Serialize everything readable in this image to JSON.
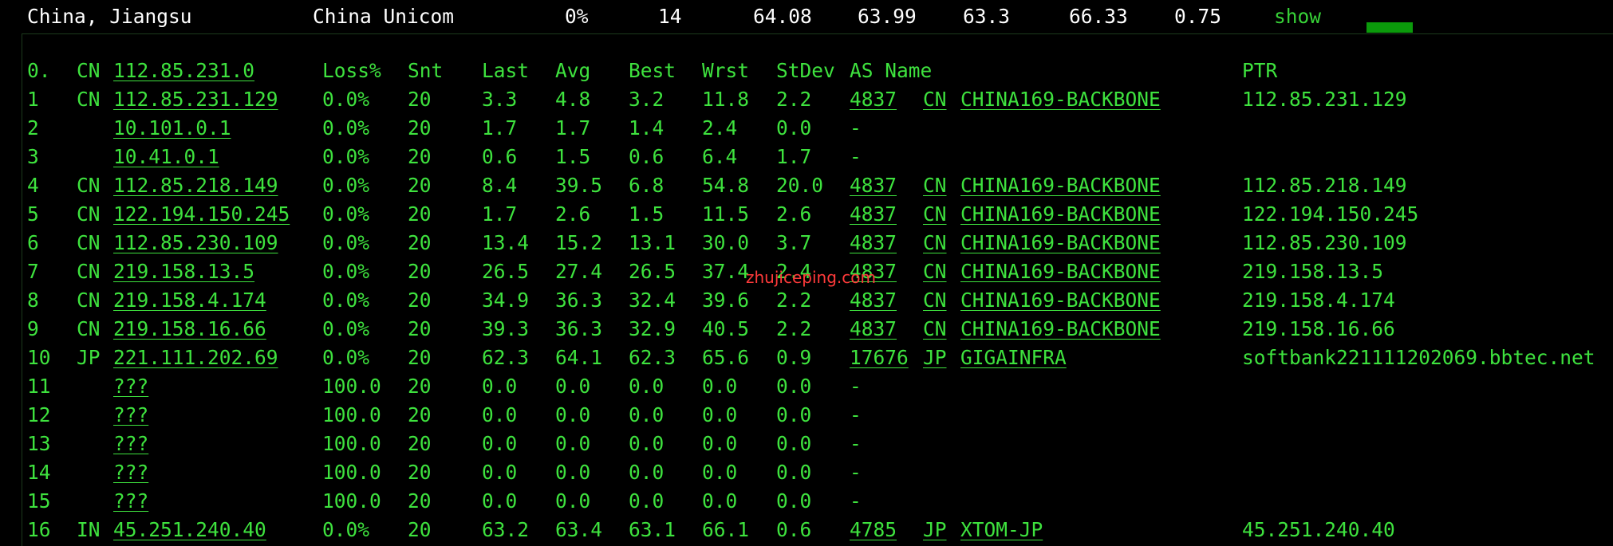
{
  "summary": {
    "location": "China, Jiangsu",
    "isp": "China Unicom",
    "loss": "0%",
    "sent": "14",
    "avg": "64.08",
    "best": "63.99",
    "worst": "63.3",
    "last": "66.33",
    "stdev": "0.75",
    "show_link": "show",
    "bar_color": "#0b9a0b"
  },
  "header": {
    "hop": "0.",
    "cc": "CN",
    "host": "112.85.231.0",
    "loss": "Loss%",
    "snt": "Snt",
    "last": "Last",
    "avg": "Avg",
    "best": "Best",
    "wrst": "Wrst",
    "stdev": "StDev",
    "as_name": "AS Name",
    "ptr": "PTR"
  },
  "rows": [
    {
      "hop": "1",
      "cc": "CN",
      "host": "112.85.231.129",
      "loss": "0.0%",
      "snt": "20",
      "last": "3.3",
      "avg": "4.8",
      "best": "3.2",
      "wrst": "11.8",
      "stdev": "2.2",
      "asn": "4837",
      "as_cc": "CN",
      "as_name": "CHINA169-BACKBONE",
      "ptr": "112.85.231.129"
    },
    {
      "hop": "2",
      "cc": "",
      "host": "10.101.0.1",
      "loss": "0.0%",
      "snt": "20",
      "last": "1.7",
      "avg": "1.7",
      "best": "1.4",
      "wrst": "2.4",
      "stdev": "0.0",
      "asn": "-",
      "as_cc": "",
      "as_name": "",
      "ptr": ""
    },
    {
      "hop": "3",
      "cc": "",
      "host": "10.41.0.1",
      "loss": "0.0%",
      "snt": "20",
      "last": "0.6",
      "avg": "1.5",
      "best": "0.6",
      "wrst": "6.4",
      "stdev": "1.7",
      "asn": "-",
      "as_cc": "",
      "as_name": "",
      "ptr": ""
    },
    {
      "hop": "4",
      "cc": "CN",
      "host": "112.85.218.149",
      "loss": "0.0%",
      "snt": "20",
      "last": "8.4",
      "avg": "39.5",
      "best": "6.8",
      "wrst": "54.8",
      "stdev": "20.0",
      "asn": "4837",
      "as_cc": "CN",
      "as_name": "CHINA169-BACKBONE",
      "ptr": "112.85.218.149"
    },
    {
      "hop": "5",
      "cc": "CN",
      "host": "122.194.150.245",
      "loss": "0.0%",
      "snt": "20",
      "last": "1.7",
      "avg": "2.6",
      "best": "1.5",
      "wrst": "11.5",
      "stdev": "2.6",
      "asn": "4837",
      "as_cc": "CN",
      "as_name": "CHINA169-BACKBONE",
      "ptr": "122.194.150.245"
    },
    {
      "hop": "6",
      "cc": "CN",
      "host": "112.85.230.109",
      "loss": "0.0%",
      "snt": "20",
      "last": "13.4",
      "avg": "15.2",
      "best": "13.1",
      "wrst": "30.0",
      "stdev": "3.7",
      "asn": "4837",
      "as_cc": "CN",
      "as_name": "CHINA169-BACKBONE",
      "ptr": "112.85.230.109"
    },
    {
      "hop": "7",
      "cc": "CN",
      "host": "219.158.13.5",
      "loss": "0.0%",
      "snt": "20",
      "last": "26.5",
      "avg": "27.4",
      "best": "26.5",
      "wrst": "37.4",
      "stdev": "2.4",
      "asn": "4837",
      "as_cc": "CN",
      "as_name": "CHINA169-BACKBONE",
      "ptr": "219.158.13.5"
    },
    {
      "hop": "8",
      "cc": "CN",
      "host": "219.158.4.174",
      "loss": "0.0%",
      "snt": "20",
      "last": "34.9",
      "avg": "36.3",
      "best": "32.4",
      "wrst": "39.6",
      "stdev": "2.2",
      "asn": "4837",
      "as_cc": "CN",
      "as_name": "CHINA169-BACKBONE",
      "ptr": "219.158.4.174"
    },
    {
      "hop": "9",
      "cc": "CN",
      "host": "219.158.16.66",
      "loss": "0.0%",
      "snt": "20",
      "last": "39.3",
      "avg": "36.3",
      "best": "32.9",
      "wrst": "40.5",
      "stdev": "2.2",
      "asn": "4837",
      "as_cc": "CN",
      "as_name": "CHINA169-BACKBONE",
      "ptr": "219.158.16.66"
    },
    {
      "hop": "10",
      "cc": "JP",
      "host": "221.111.202.69",
      "loss": "0.0%",
      "snt": "20",
      "last": "62.3",
      "avg": "64.1",
      "best": "62.3",
      "wrst": "65.6",
      "stdev": "0.9",
      "asn": "17676",
      "as_cc": "JP",
      "as_name": "GIGAINFRA",
      "ptr": "softbank221111202069.bbtec.net"
    },
    {
      "hop": "11",
      "cc": "",
      "host": "???",
      "loss": "100.0",
      "snt": "20",
      "last": "0.0",
      "avg": "0.0",
      "best": "0.0",
      "wrst": "0.0",
      "stdev": "0.0",
      "asn": "-",
      "as_cc": "",
      "as_name": "",
      "ptr": ""
    },
    {
      "hop": "12",
      "cc": "",
      "host": "???",
      "loss": "100.0",
      "snt": "20",
      "last": "0.0",
      "avg": "0.0",
      "best": "0.0",
      "wrst": "0.0",
      "stdev": "0.0",
      "asn": "-",
      "as_cc": "",
      "as_name": "",
      "ptr": ""
    },
    {
      "hop": "13",
      "cc": "",
      "host": "???",
      "loss": "100.0",
      "snt": "20",
      "last": "0.0",
      "avg": "0.0",
      "best": "0.0",
      "wrst": "0.0",
      "stdev": "0.0",
      "asn": "-",
      "as_cc": "",
      "as_name": "",
      "ptr": ""
    },
    {
      "hop": "14",
      "cc": "",
      "host": "???",
      "loss": "100.0",
      "snt": "20",
      "last": "0.0",
      "avg": "0.0",
      "best": "0.0",
      "wrst": "0.0",
      "stdev": "0.0",
      "asn": "-",
      "as_cc": "",
      "as_name": "",
      "ptr": ""
    },
    {
      "hop": "15",
      "cc": "",
      "host": "???",
      "loss": "100.0",
      "snt": "20",
      "last": "0.0",
      "avg": "0.0",
      "best": "0.0",
      "wrst": "0.0",
      "stdev": "0.0",
      "asn": "-",
      "as_cc": "",
      "as_name": "",
      "ptr": ""
    },
    {
      "hop": "16",
      "cc": "IN",
      "host": "45.251.240.40",
      "loss": "0.0%",
      "snt": "20",
      "last": "63.2",
      "avg": "63.4",
      "best": "63.1",
      "wrst": "66.1",
      "stdev": "0.6",
      "asn": "4785",
      "as_cc": "JP",
      "as_name": "XTOM-JP",
      "ptr": "45.251.240.40"
    }
  ],
  "watermark": "zhujiceping.com"
}
